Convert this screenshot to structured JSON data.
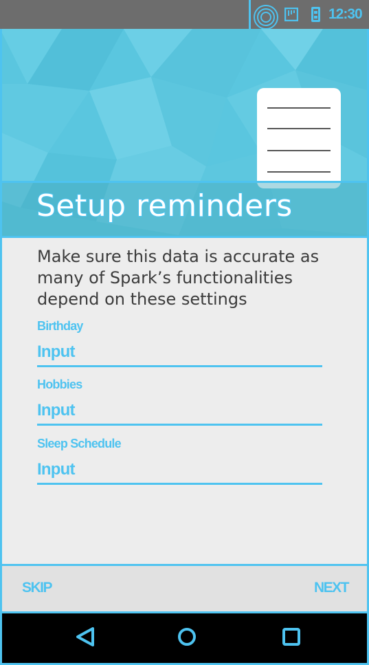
{
  "status_bar": {
    "time": "12:30",
    "icons": [
      "wifi-icon",
      "signal-icon",
      "battery-icon"
    ]
  },
  "hero": {
    "title": "Setup reminders",
    "illustration": "notepad-icon"
  },
  "form": {
    "intro": "Make sure this data is accurate as many of Spark’s functionalities depend on these settings",
    "fields": [
      {
        "label": "Birthday",
        "value": "Input"
      },
      {
        "label": "Hobbies",
        "value": "Input"
      },
      {
        "label": "Sleep Schedule",
        "value": "Input"
      }
    ]
  },
  "actions": {
    "skip_label": "SKIP",
    "next_label": "NEXT"
  },
  "nav_bar": {
    "buttons": [
      "back-icon",
      "home-icon",
      "recents-icon"
    ]
  },
  "colors": {
    "accent": "#4ec3f0",
    "hero_background": "#5ac6df",
    "status_bar": "#6d6d6d",
    "page_background": "#ededed",
    "body_text": "#3b3b3b"
  }
}
